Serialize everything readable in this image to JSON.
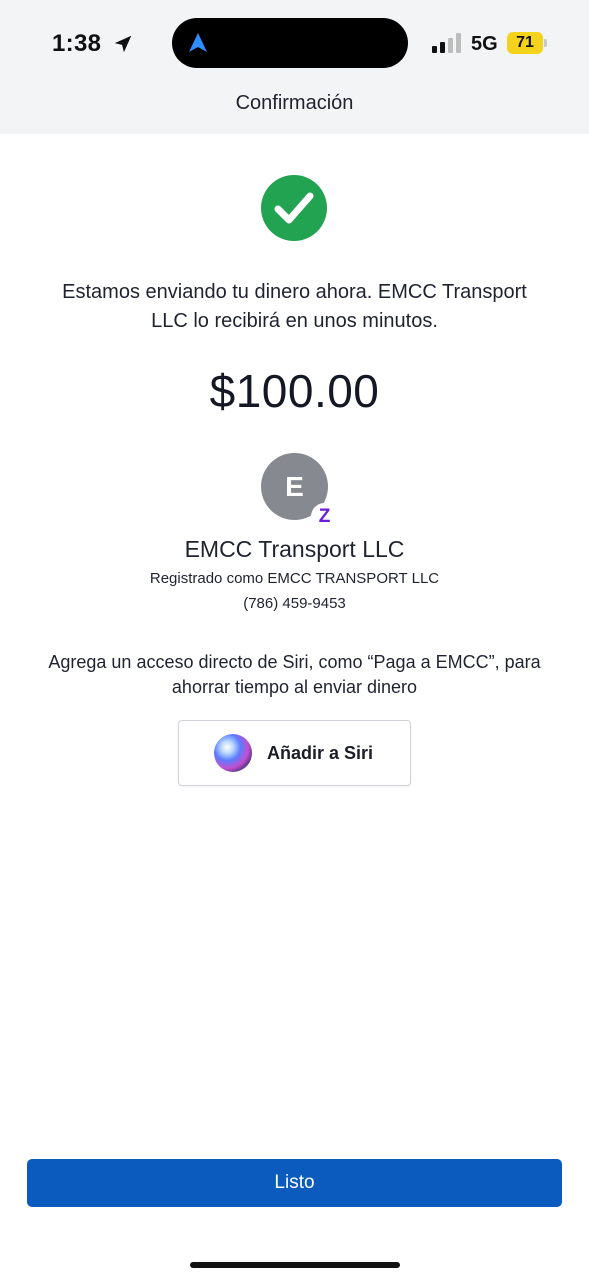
{
  "status_bar": {
    "time": "1:38",
    "network": "5G",
    "battery": "71"
  },
  "header": {
    "title": "Confirmación"
  },
  "confirmation": {
    "message": "Estamos enviando tu dinero ahora. EMCC Transport LLC lo recibirá en unos minutos.",
    "amount": "$100.00"
  },
  "recipient": {
    "initial": "E",
    "badge": "Z",
    "name": "EMCC Transport LLC",
    "registered_as": "Registrado como EMCC TRANSPORT LLC",
    "phone": "(786) 459-9453"
  },
  "siri": {
    "message": "Agrega un acceso directo de Siri, como “Paga a EMCC”, para ahorrar tiempo al enviar dinero",
    "button_label": "Añadir a Siri"
  },
  "footer": {
    "done_label": "Listo"
  },
  "colors": {
    "primary": "#0a5bbd",
    "success": "#22a352",
    "zelle": "#6d1ed4",
    "battery": "#f5d21c"
  },
  "icons": [
    "location-arrow-icon",
    "navigation-arrow-icon",
    "signal-icon",
    "battery-icon",
    "checkmark-icon",
    "zelle-icon",
    "siri-icon"
  ]
}
